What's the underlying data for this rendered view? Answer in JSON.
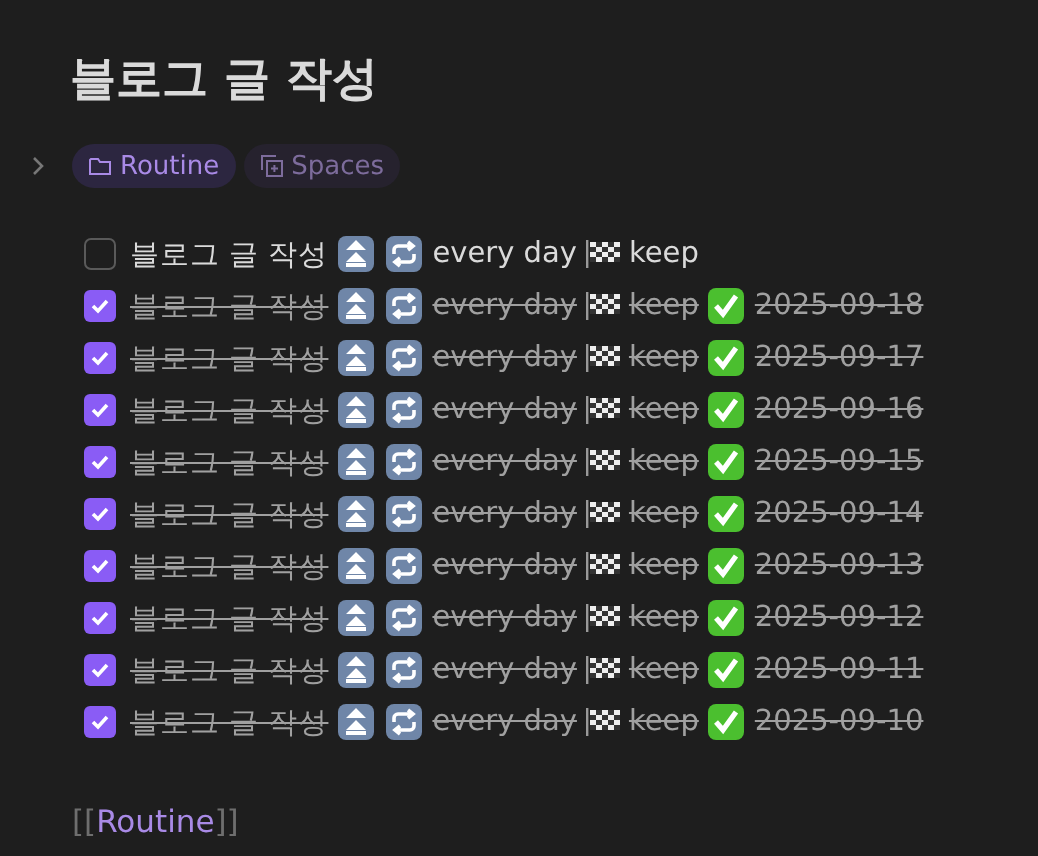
{
  "title": "블로그 글 작성",
  "tags": [
    {
      "kind": "folder",
      "label": "Routine",
      "selected": true
    },
    {
      "kind": "spaces",
      "label": "Spaces",
      "selected": false
    }
  ],
  "tasks": [
    {
      "checked": false,
      "text": "블로그 글 작성",
      "recurrence": "every day",
      "flag_text": "keep"
    },
    {
      "checked": true,
      "text": "블로그 글 작성",
      "recurrence": "every day",
      "flag_text": "keep",
      "done_date": "2025-09-18"
    },
    {
      "checked": true,
      "text": "블로그 글 작성",
      "recurrence": "every day",
      "flag_text": "keep",
      "done_date": "2025-09-17"
    },
    {
      "checked": true,
      "text": "블로그 글 작성",
      "recurrence": "every day",
      "flag_text": "keep",
      "done_date": "2025-09-16"
    },
    {
      "checked": true,
      "text": "블로그 글 작성",
      "recurrence": "every day",
      "flag_text": "keep",
      "done_date": "2025-09-15"
    },
    {
      "checked": true,
      "text": "블로그 글 작성",
      "recurrence": "every day",
      "flag_text": "keep",
      "done_date": "2025-09-14"
    },
    {
      "checked": true,
      "text": "블로그 글 작성",
      "recurrence": "every day",
      "flag_text": "keep",
      "done_date": "2025-09-13"
    },
    {
      "checked": true,
      "text": "블로그 글 작성",
      "recurrence": "every day",
      "flag_text": "keep",
      "done_date": "2025-09-12"
    },
    {
      "checked": true,
      "text": "블로그 글 작성",
      "recurrence": "every day",
      "flag_text": "keep",
      "done_date": "2025-09-11"
    },
    {
      "checked": true,
      "text": "블로그 글 작성",
      "recurrence": "every day",
      "flag_text": "keep",
      "done_date": "2025-09-10"
    }
  ],
  "link": {
    "open_brackets": "[[",
    "label": "Routine",
    "close_brackets": "]]"
  }
}
